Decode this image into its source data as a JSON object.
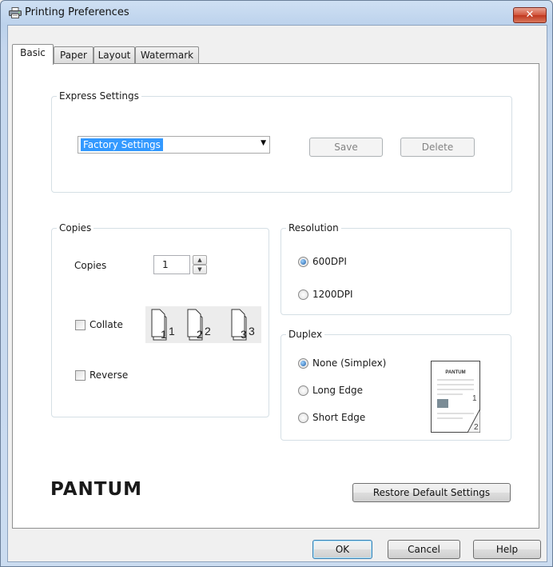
{
  "window": {
    "title": "Printing Preferences",
    "close_glyph": "✕"
  },
  "tabs": [
    {
      "label": "Basic",
      "active": true
    },
    {
      "label": "Paper",
      "active": false
    },
    {
      "label": "Layout",
      "active": false
    },
    {
      "label": "Watermark",
      "active": false
    }
  ],
  "express_settings": {
    "legend": "Express Settings",
    "selected": "Factory Settings",
    "save_label": "Save",
    "delete_label": "Delete"
  },
  "copies": {
    "legend": "Copies",
    "copies_label": "Copies",
    "copies_value": "1",
    "collate_label": "Collate",
    "collate_checked": false,
    "reverse_label": "Reverse",
    "reverse_checked": false,
    "collate_pages": [
      "1",
      "2",
      "3"
    ]
  },
  "resolution": {
    "legend": "Resolution",
    "options": [
      {
        "label": "600DPI",
        "selected": true
      },
      {
        "label": "1200DPI",
        "selected": false
      }
    ]
  },
  "duplex": {
    "legend": "Duplex",
    "options": [
      {
        "label": "None (Simplex)",
        "selected": true
      },
      {
        "label": "Long Edge",
        "selected": false
      },
      {
        "label": "Short Edge",
        "selected": false
      }
    ],
    "preview_brand": "PANTUM",
    "preview_pages": [
      "1",
      "2"
    ]
  },
  "brand": {
    "logo_text": "PANTUM"
  },
  "restore_label": "Restore Default Settings",
  "footer": {
    "ok_label": "OK",
    "cancel_label": "Cancel",
    "help_label": "Help"
  },
  "icons": {
    "title": "printer-icon",
    "close": "close-icon",
    "combo_arrow": "chevron-down-icon",
    "spin_up": "spin-up-icon",
    "spin_down": "spin-down-icon"
  }
}
